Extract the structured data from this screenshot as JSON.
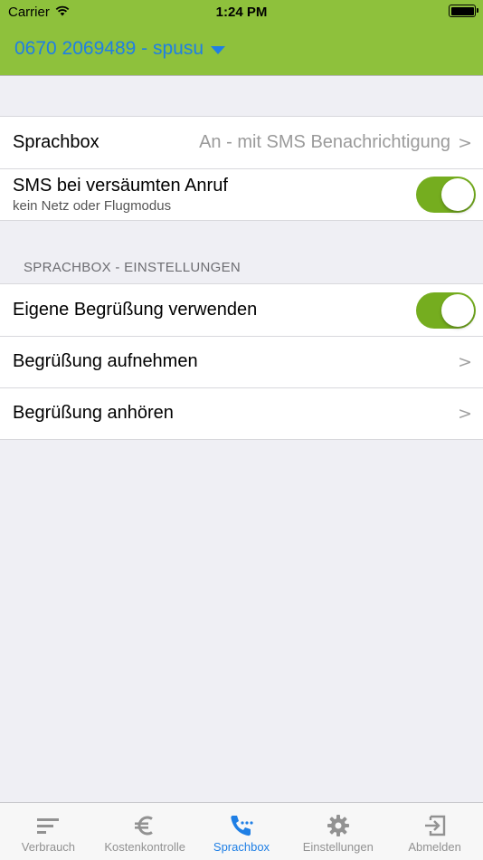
{
  "status_bar": {
    "carrier": "Carrier",
    "time": "1:24 PM",
    "battery_level": 1.0
  },
  "nav": {
    "title": "0670 2069489 - spusu",
    "accent_color": "#8ec13c",
    "link_color": "#1f7fe5"
  },
  "group1": {
    "sprachbox": {
      "label": "Sprachbox",
      "value": "An - mit SMS Benachrichtigung",
      "chevron": ">"
    },
    "sms_missed": {
      "label": "SMS bei versäumten Anruf",
      "sublabel": "kein Netz oder Flugmodus",
      "enabled": true
    }
  },
  "section_header": "SPRACHBOX - EINSTELLUNGEN",
  "group2": {
    "own_greeting": {
      "label": "Eigene Begrüßung verwenden",
      "enabled": true
    },
    "record_greeting": {
      "label": "Begrüßung aufnehmen",
      "chevron": ">"
    },
    "listen_greeting": {
      "label": "Begrüßung anhören",
      "chevron": ">"
    }
  },
  "tabs": [
    {
      "label": "Verbrauch",
      "icon": "bars-icon",
      "active": false
    },
    {
      "label": "Kostenkontrolle",
      "icon": "euro-icon",
      "active": false
    },
    {
      "label": "Sprachbox",
      "icon": "phone-dots-icon",
      "active": true
    },
    {
      "label": "Einstellungen",
      "icon": "gear-icon",
      "active": false
    },
    {
      "label": "Abmelden",
      "icon": "logout-icon",
      "active": false
    }
  ]
}
